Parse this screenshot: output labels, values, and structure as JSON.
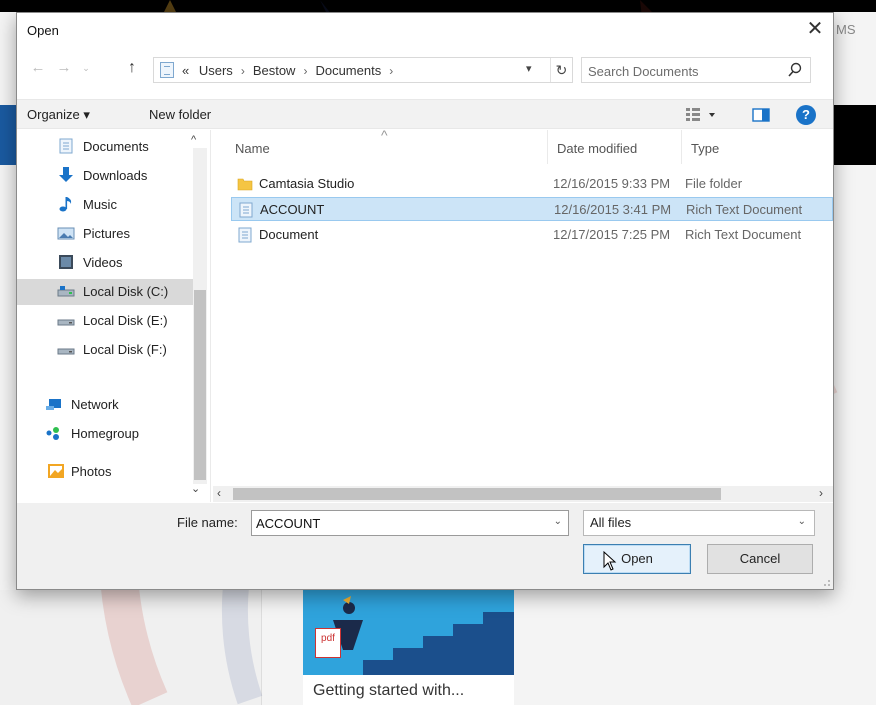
{
  "background": {
    "right_label": "MS",
    "card_pdf_label": "pdf",
    "card_title": "Getting started with..."
  },
  "dialog": {
    "title": "Open",
    "close_glyph": "✕"
  },
  "address": {
    "breadcrumb": [
      "«",
      "Users",
      "Bestow",
      "Documents"
    ],
    "separator": "›",
    "search_placeholder": "Search Documents"
  },
  "toolbar": {
    "organize_label": "Organize ▾",
    "new_folder_label": "New folder",
    "help_label": "?"
  },
  "nav_pane": {
    "items": [
      {
        "label": "Documents",
        "icon": "documents-icon"
      },
      {
        "label": "Downloads",
        "icon": "downloads-icon"
      },
      {
        "label": "Music",
        "icon": "music-icon"
      },
      {
        "label": "Pictures",
        "icon": "pictures-icon"
      },
      {
        "label": "Videos",
        "icon": "videos-icon"
      },
      {
        "label": "Local Disk (C:)",
        "icon": "drive-c-icon",
        "selected": true
      },
      {
        "label": "Local Disk (E:)",
        "icon": "drive-icon"
      },
      {
        "label": "Local Disk (F:)",
        "icon": "drive-icon"
      },
      {
        "label": "Network",
        "icon": "network-icon"
      },
      {
        "label": "Homegroup",
        "icon": "homegroup-icon"
      },
      {
        "label": "Photos",
        "icon": "photos-icon"
      }
    ]
  },
  "file_list": {
    "columns": [
      "Name",
      "Date modified",
      "Type"
    ],
    "rows": [
      {
        "name": "Camtasia Studio",
        "date": "12/16/2015 9:33 PM",
        "type": "File folder",
        "icon": "folder-icon"
      },
      {
        "name": "ACCOUNT",
        "date": "12/16/2015 3:41 PM",
        "type": "Rich Text Document",
        "icon": "rtf-document-icon",
        "selected": true
      },
      {
        "name": "Document",
        "date": "12/17/2015 7:25 PM",
        "type": "Rich Text Document",
        "icon": "rtf-document-icon"
      }
    ]
  },
  "bottom": {
    "filename_label": "File name:",
    "filename_value": "ACCOUNT",
    "filetype_value": "All files",
    "open_label": "Open",
    "cancel_label": "Cancel"
  },
  "colors": {
    "accent": "#1a73c8",
    "selection": "#cce4f7",
    "folder": "#f5c543"
  }
}
